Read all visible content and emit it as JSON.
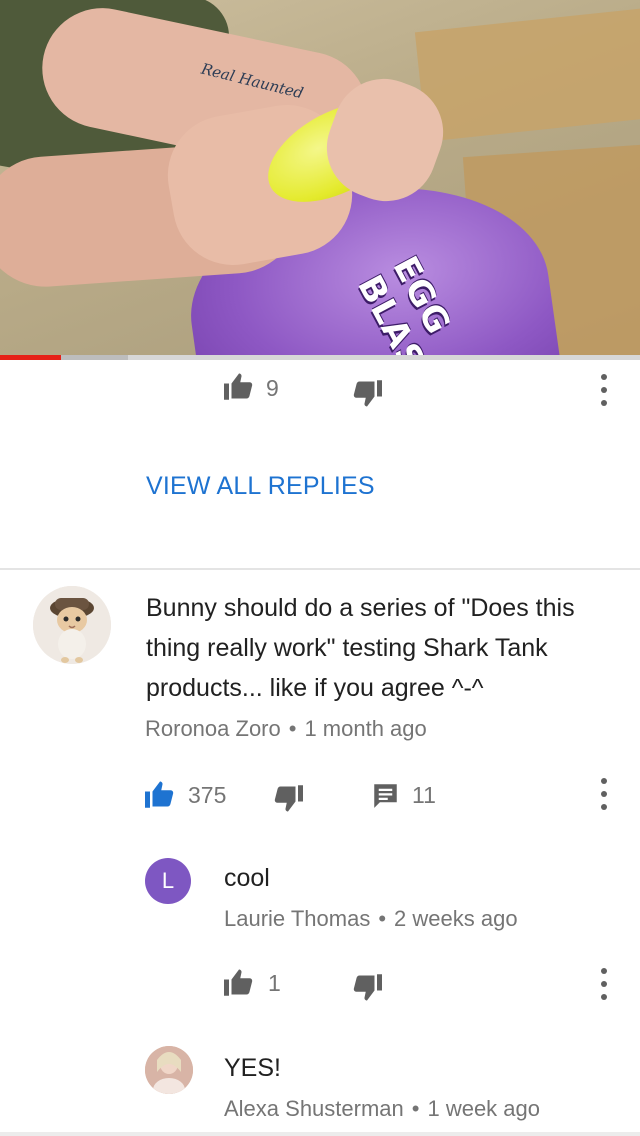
{
  "video": {
    "product_logo_text": "EGG BLAST!",
    "tattoo_text": "Real Haunted",
    "progress_percent": 9.5,
    "buffered_percent": 20,
    "colors": {
      "played": "#e62117",
      "buffer": "#bdbdbd",
      "track": "#d7d7d7"
    }
  },
  "prev_reply_actions": {
    "like_count": "9"
  },
  "view_all_replies_label": "VIEW ALL REPLIES",
  "comment": {
    "text": "Bunny should do a series of  \"Does this thing really work\"  testing Shark Tank products... like if you agree ^-^",
    "author": "Roronoa Zoro",
    "separator": "•",
    "age": "1 month ago",
    "like_count": "375",
    "reply_count": "11",
    "liked": true,
    "accent_color": "#1e73d1"
  },
  "replies": [
    {
      "avatar_letter": "L",
      "avatar_color": "#7e57c2",
      "text": "cool",
      "author": "Laurie Thomas",
      "separator": "•",
      "age": "2 weeks ago",
      "like_count": "1"
    },
    {
      "text": "YES!",
      "author": "Alexa Shusterman",
      "separator": "•",
      "age": "1 week ago"
    }
  ]
}
